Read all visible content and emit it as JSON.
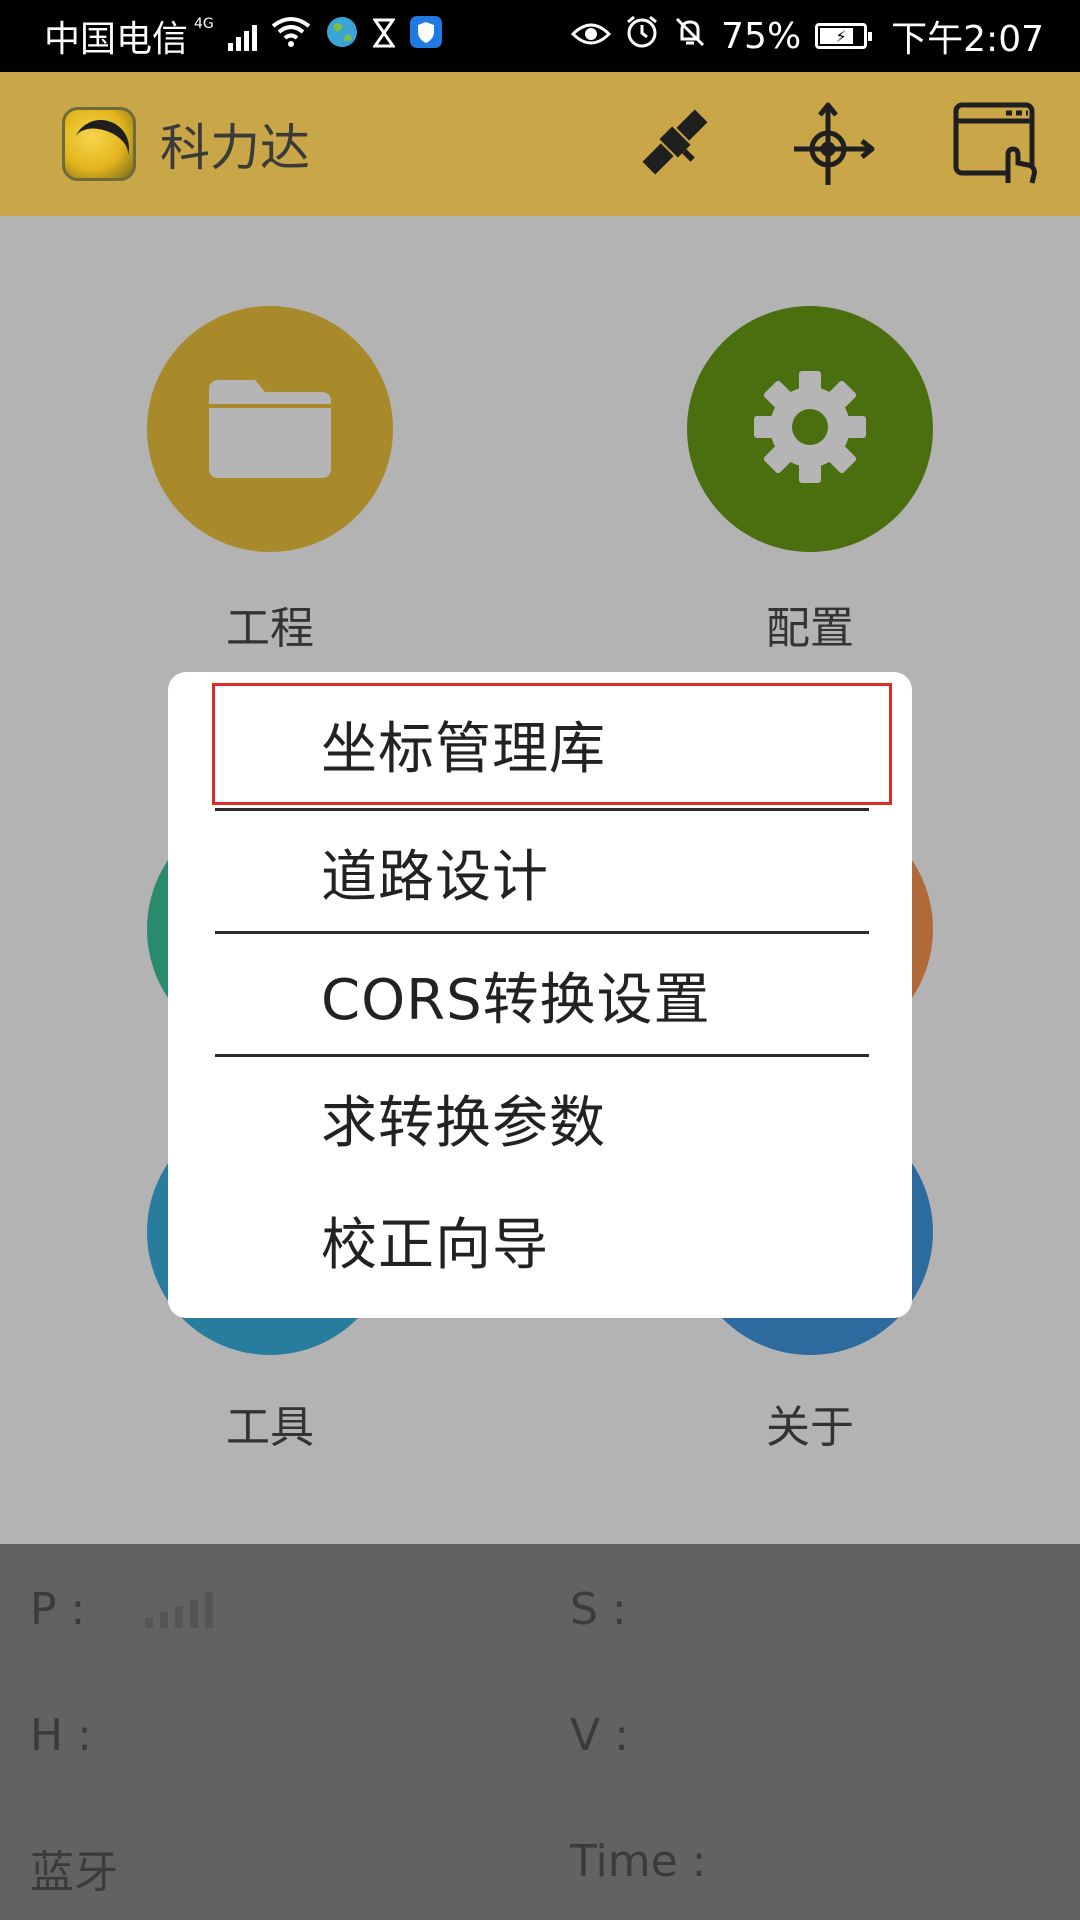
{
  "status_bar": {
    "carrier": "中国电信",
    "network": "4G",
    "battery": "75%",
    "time": "下午2:07",
    "icons": [
      "signal-icon",
      "wifi-icon",
      "earth-icon",
      "hourglass-icon",
      "shield-icon",
      "eye-icon",
      "alarm-icon",
      "mute-bell-icon",
      "battery-icon"
    ]
  },
  "app_bar": {
    "title": "科力达",
    "actions": [
      "satellite-icon",
      "crosshair-arrow-icon",
      "window-hand-icon"
    ]
  },
  "tiles": [
    {
      "label": "工程",
      "icon": "folder-icon",
      "color": "#a88a2b"
    },
    {
      "label": "配置",
      "icon": "gear-icon",
      "color": "#4b6f0e"
    },
    {
      "label": "工具",
      "color": "#287c9e"
    },
    {
      "label": "关于",
      "color": "#2d6a9e"
    }
  ],
  "dialog": {
    "items": [
      "坐标管理库",
      "道路设计",
      "CORS转换设置",
      "求转换参数",
      "校正向导"
    ],
    "highlight_color": "#e32a2a"
  },
  "bottom_info": {
    "p_label": "P :",
    "s_label": "S :",
    "h_label": "H :",
    "v_label": "V :",
    "bt_label": "蓝牙",
    "time_label": "Time :"
  },
  "colors": {
    "app_bar": "#c9a648",
    "overlay": "#b3b3b3",
    "bottom_panel": "#626262"
  }
}
